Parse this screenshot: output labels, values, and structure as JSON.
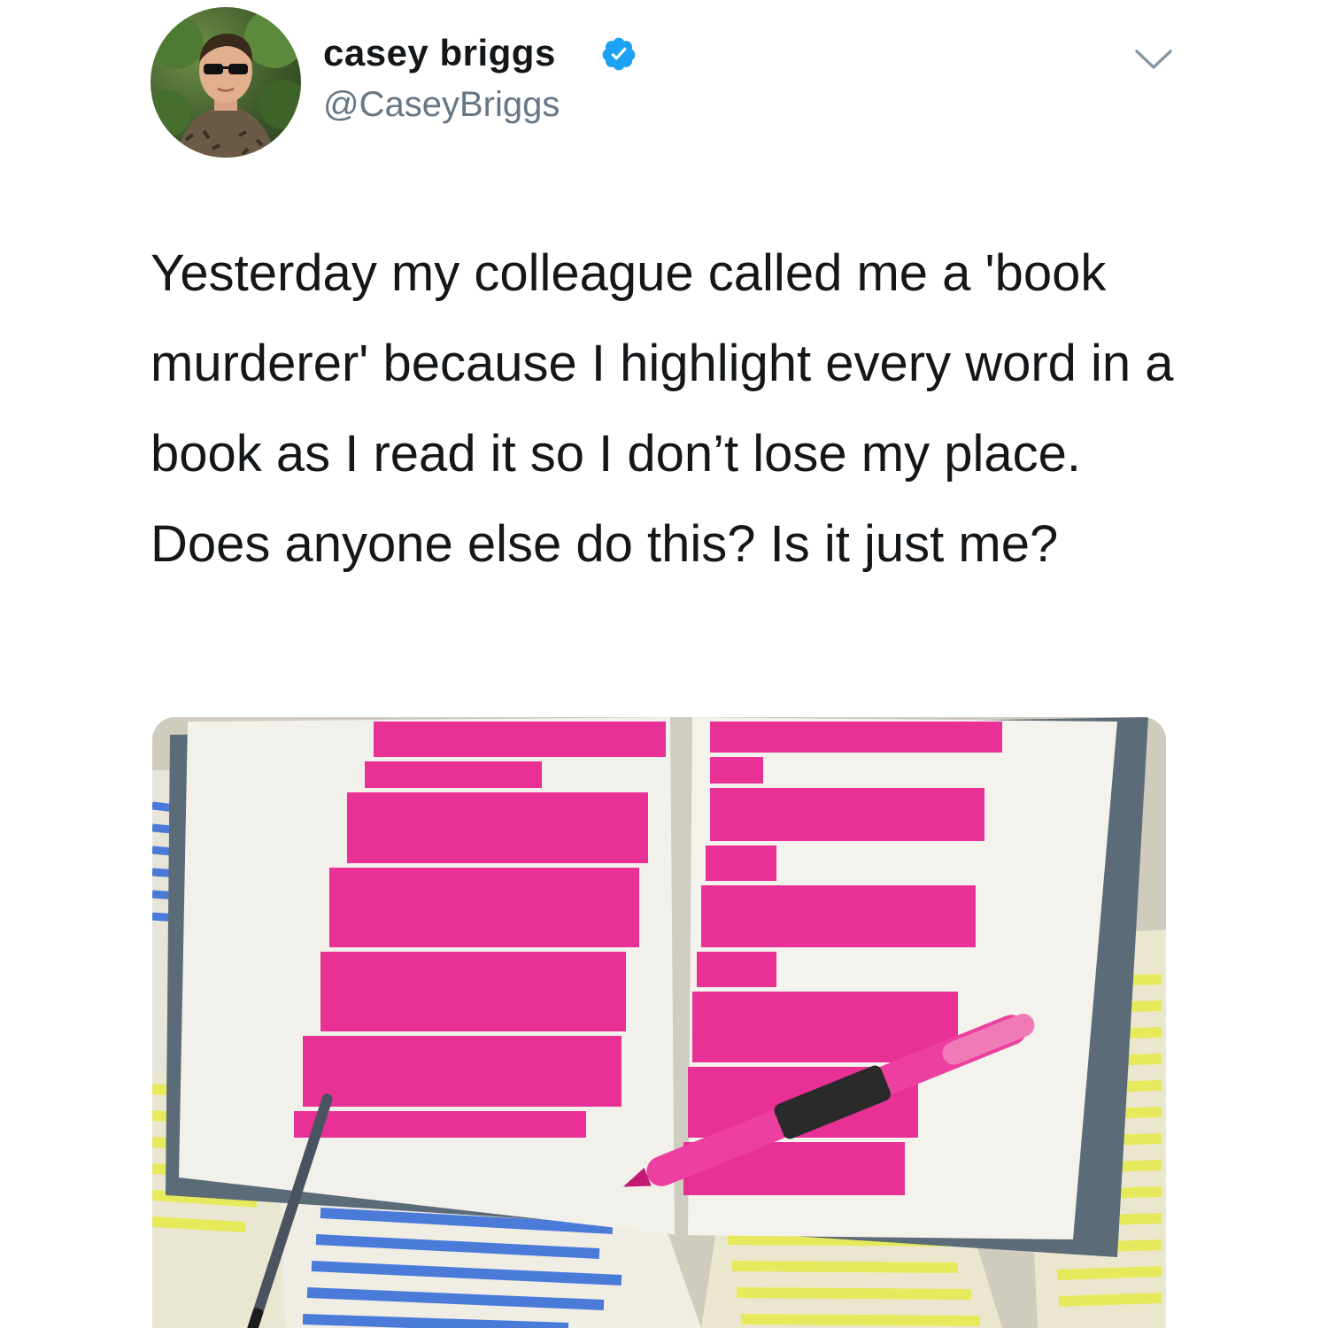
{
  "tweet": {
    "author": {
      "display_name": "casey briggs",
      "handle": "@CaseyBriggs",
      "verified": true
    },
    "text": "Yesterday my colleague called me a 'book murderer' because I highlight every word in a book as I read it so I don’t lose my place. Does anyone else do this? Is it just me?",
    "menu_icon": "chevron-down-icon",
    "media": {
      "kind": "photo",
      "highlight_colors": [
        "#e8208e",
        "#3a6fd8",
        "#e6ea55"
      ]
    }
  },
  "colors": {
    "verified_badge": "#1da1f2",
    "handle_text": "#657786",
    "body_text": "#14171a"
  }
}
